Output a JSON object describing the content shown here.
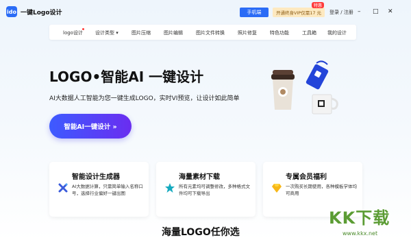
{
  "app": {
    "logo_text": "ido",
    "title": "一键Logo设计"
  },
  "titlebar": {
    "phone_button": "手机端",
    "vip_button": "开通终身VIP仅需17 元",
    "vip_badge": "特惠",
    "login": "登录 / 注册",
    "min_icon": "–",
    "max_icon": "□",
    "close_icon": "✕"
  },
  "nav": {
    "items": [
      {
        "label": "logo设计"
      },
      {
        "label": "设计类型 ▾"
      },
      {
        "label": "图片压缩"
      },
      {
        "label": "图片编辑"
      },
      {
        "label": "图片文件转换"
      },
      {
        "label": "照片修复"
      },
      {
        "label": "特色功能"
      },
      {
        "label": "工具箱"
      },
      {
        "label": "我的设计"
      }
    ]
  },
  "hero": {
    "title": "LOGO•智能AI 一键设计",
    "subtitle": "AI大数据人工智能为您一键生成LOGO，实时VI预览，让设计如此简单",
    "cta": "智能AI一键设计 »"
  },
  "cards": [
    {
      "title": "智能设计生成器",
      "text": "AI大数据计算，只需简单输入名称口号，选择行业偏好一键出图",
      "icon": "ai-cross-icon"
    },
    {
      "title": "海量素材下载",
      "text": "所有元素均可调整修改，多种格式文件均可下载导出",
      "icon": "star-icon"
    },
    {
      "title": "专属会员福利",
      "text": "一次购买长期使用，各种模板学体均可商用",
      "icon": "diamond-icon"
    }
  ],
  "section": {
    "title": "海量LOGO任你选"
  },
  "watermark": {
    "text": "KK下载",
    "url": "www.kkx.net"
  },
  "colors": {
    "accent": "#2b6cf6",
    "cta_start": "#3d5bff",
    "cta_end": "#6a2df0",
    "vip_bg": "#fde9c0",
    "badge": "#ff3b3b"
  }
}
